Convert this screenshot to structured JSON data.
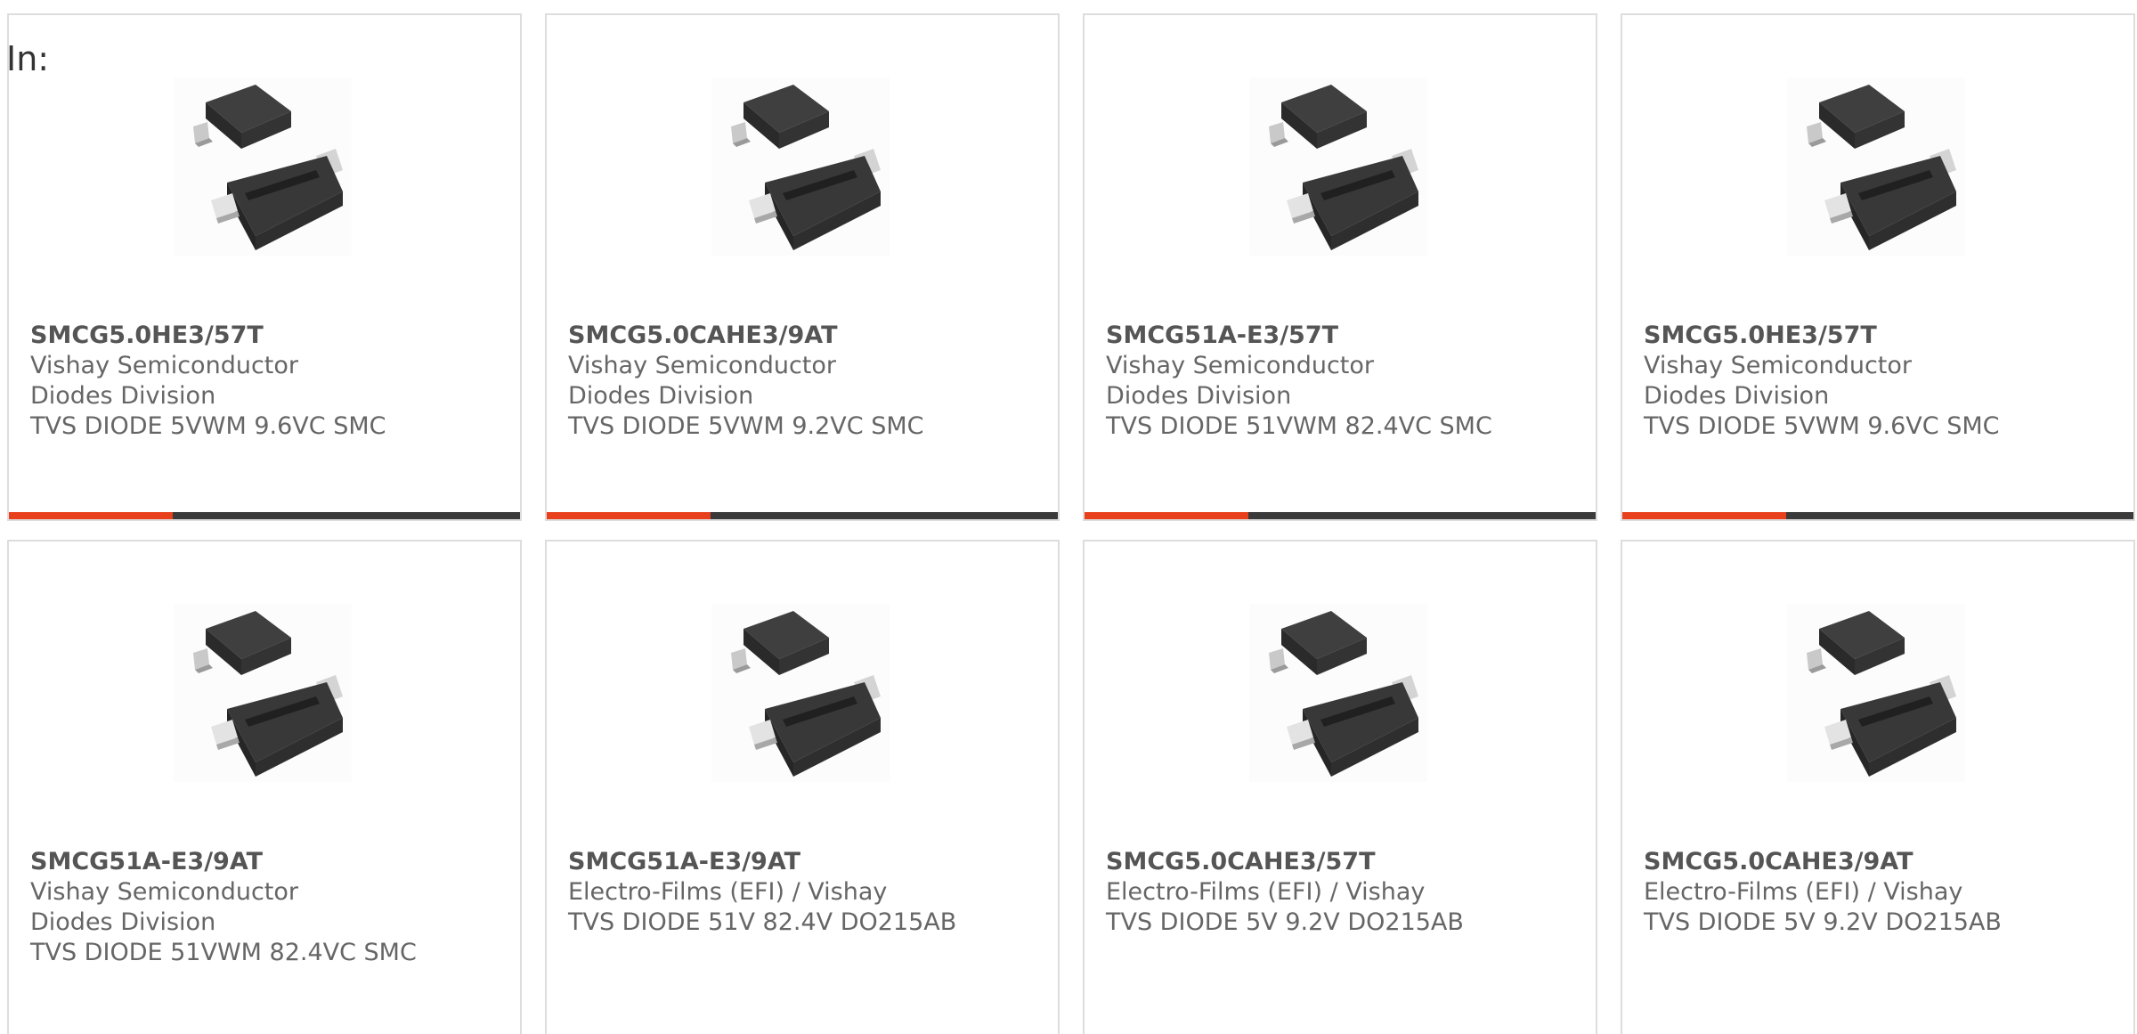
{
  "header": {
    "in_label": "In:"
  },
  "colors": {
    "accent": "#e8401c",
    "bar": "#3a3a3a",
    "border": "#dddddd",
    "text": "#666666"
  },
  "product_image_icon": "smc-diode-package-icon",
  "products": [
    {
      "part_number": "SMCG5.0HE3/57T",
      "manufacturer": "Vishay Semiconductor Diodes Division",
      "description": "TVS DIODE 5VWM 9.6VC SMC"
    },
    {
      "part_number": "SMCG5.0CAHE3/9AT",
      "manufacturer": "Vishay Semiconductor Diodes Division",
      "description": "TVS DIODE 5VWM 9.2VC SMC"
    },
    {
      "part_number": "SMCG51A-E3/57T",
      "manufacturer": "Vishay Semiconductor Diodes Division",
      "description": "TVS DIODE 51VWM 82.4VC SMC"
    },
    {
      "part_number": "SMCG5.0HE3/57T",
      "manufacturer": "Vishay Semiconductor Diodes Division",
      "description": "TVS DIODE 5VWM 9.6VC SMC"
    },
    {
      "part_number": "SMCG51A-E3/9AT",
      "manufacturer": "Vishay Semiconductor Diodes Division",
      "description": "TVS DIODE 51VWM 82.4VC SMC"
    },
    {
      "part_number": "SMCG51A-E3/9AT",
      "manufacturer": "Electro-Films (EFI) / Vishay",
      "description": "TVS DIODE 51V 82.4V DO215AB"
    },
    {
      "part_number": "SMCG5.0CAHE3/57T",
      "manufacturer": "Electro-Films (EFI) / Vishay",
      "description": "TVS DIODE 5V 9.2V DO215AB"
    },
    {
      "part_number": "SMCG5.0CAHE3/9AT",
      "manufacturer": "Electro-Films (EFI) / Vishay",
      "description": "TVS DIODE 5V 9.2V DO215AB"
    }
  ]
}
